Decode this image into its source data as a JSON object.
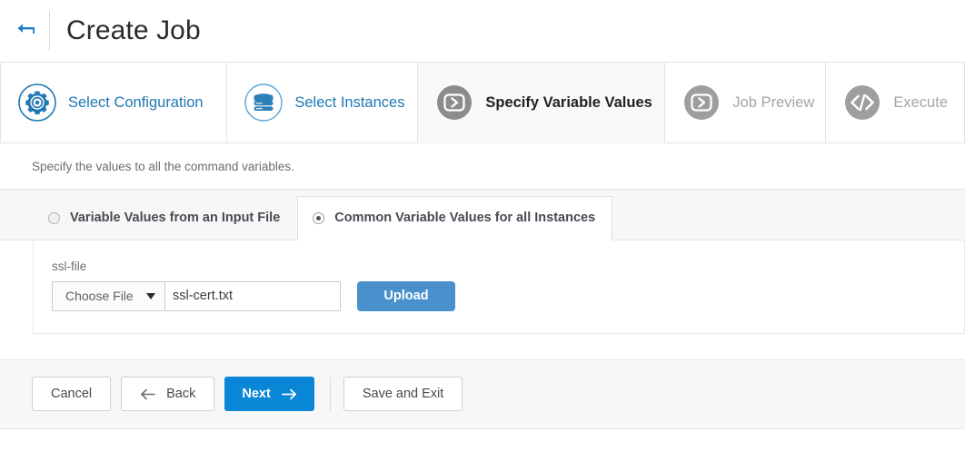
{
  "header": {
    "back_icon": "back-arrow-icon",
    "title": "Create Job"
  },
  "wizard": {
    "tabs": [
      {
        "label": "Select Configuration",
        "icon": "gear-circle-icon",
        "state": "done"
      },
      {
        "label": "Select Instances",
        "icon": "server-stack-circle-icon",
        "state": "done"
      },
      {
        "label": "Specify Variable Values",
        "icon": "play-box-circle-icon",
        "state": "active"
      },
      {
        "label": "Job Preview",
        "icon": "play-box-circle-icon",
        "state": "todo"
      },
      {
        "label": "Execute",
        "icon": "code-brackets-circle-icon",
        "state": "todo"
      }
    ]
  },
  "description": "Specify the values to all the command variables.",
  "variable_source": {
    "options": [
      {
        "label": "Variable Values from an Input File",
        "selected": false
      },
      {
        "label": "Common Variable Values for all Instances",
        "selected": true
      }
    ]
  },
  "variable_form": {
    "field_label": "ssl-file",
    "choose_file_label": "Choose File",
    "caret_icon": "chevron-down-icon",
    "file_name": "ssl-cert.txt",
    "upload_label": "Upload"
  },
  "footer": {
    "cancel_label": "Cancel",
    "back_label": "Back",
    "back_icon": "arrow-left-icon",
    "next_label": "Next",
    "next_icon": "arrow-right-icon",
    "save_exit_label": "Save and Exit"
  },
  "colors": {
    "accent_blue": "#0a86d6",
    "tab_blue": "#2079b3",
    "upload_blue": "#4a90cd",
    "muted_gray": "#a6a6a6",
    "panel_gray": "#f7f7f7"
  }
}
